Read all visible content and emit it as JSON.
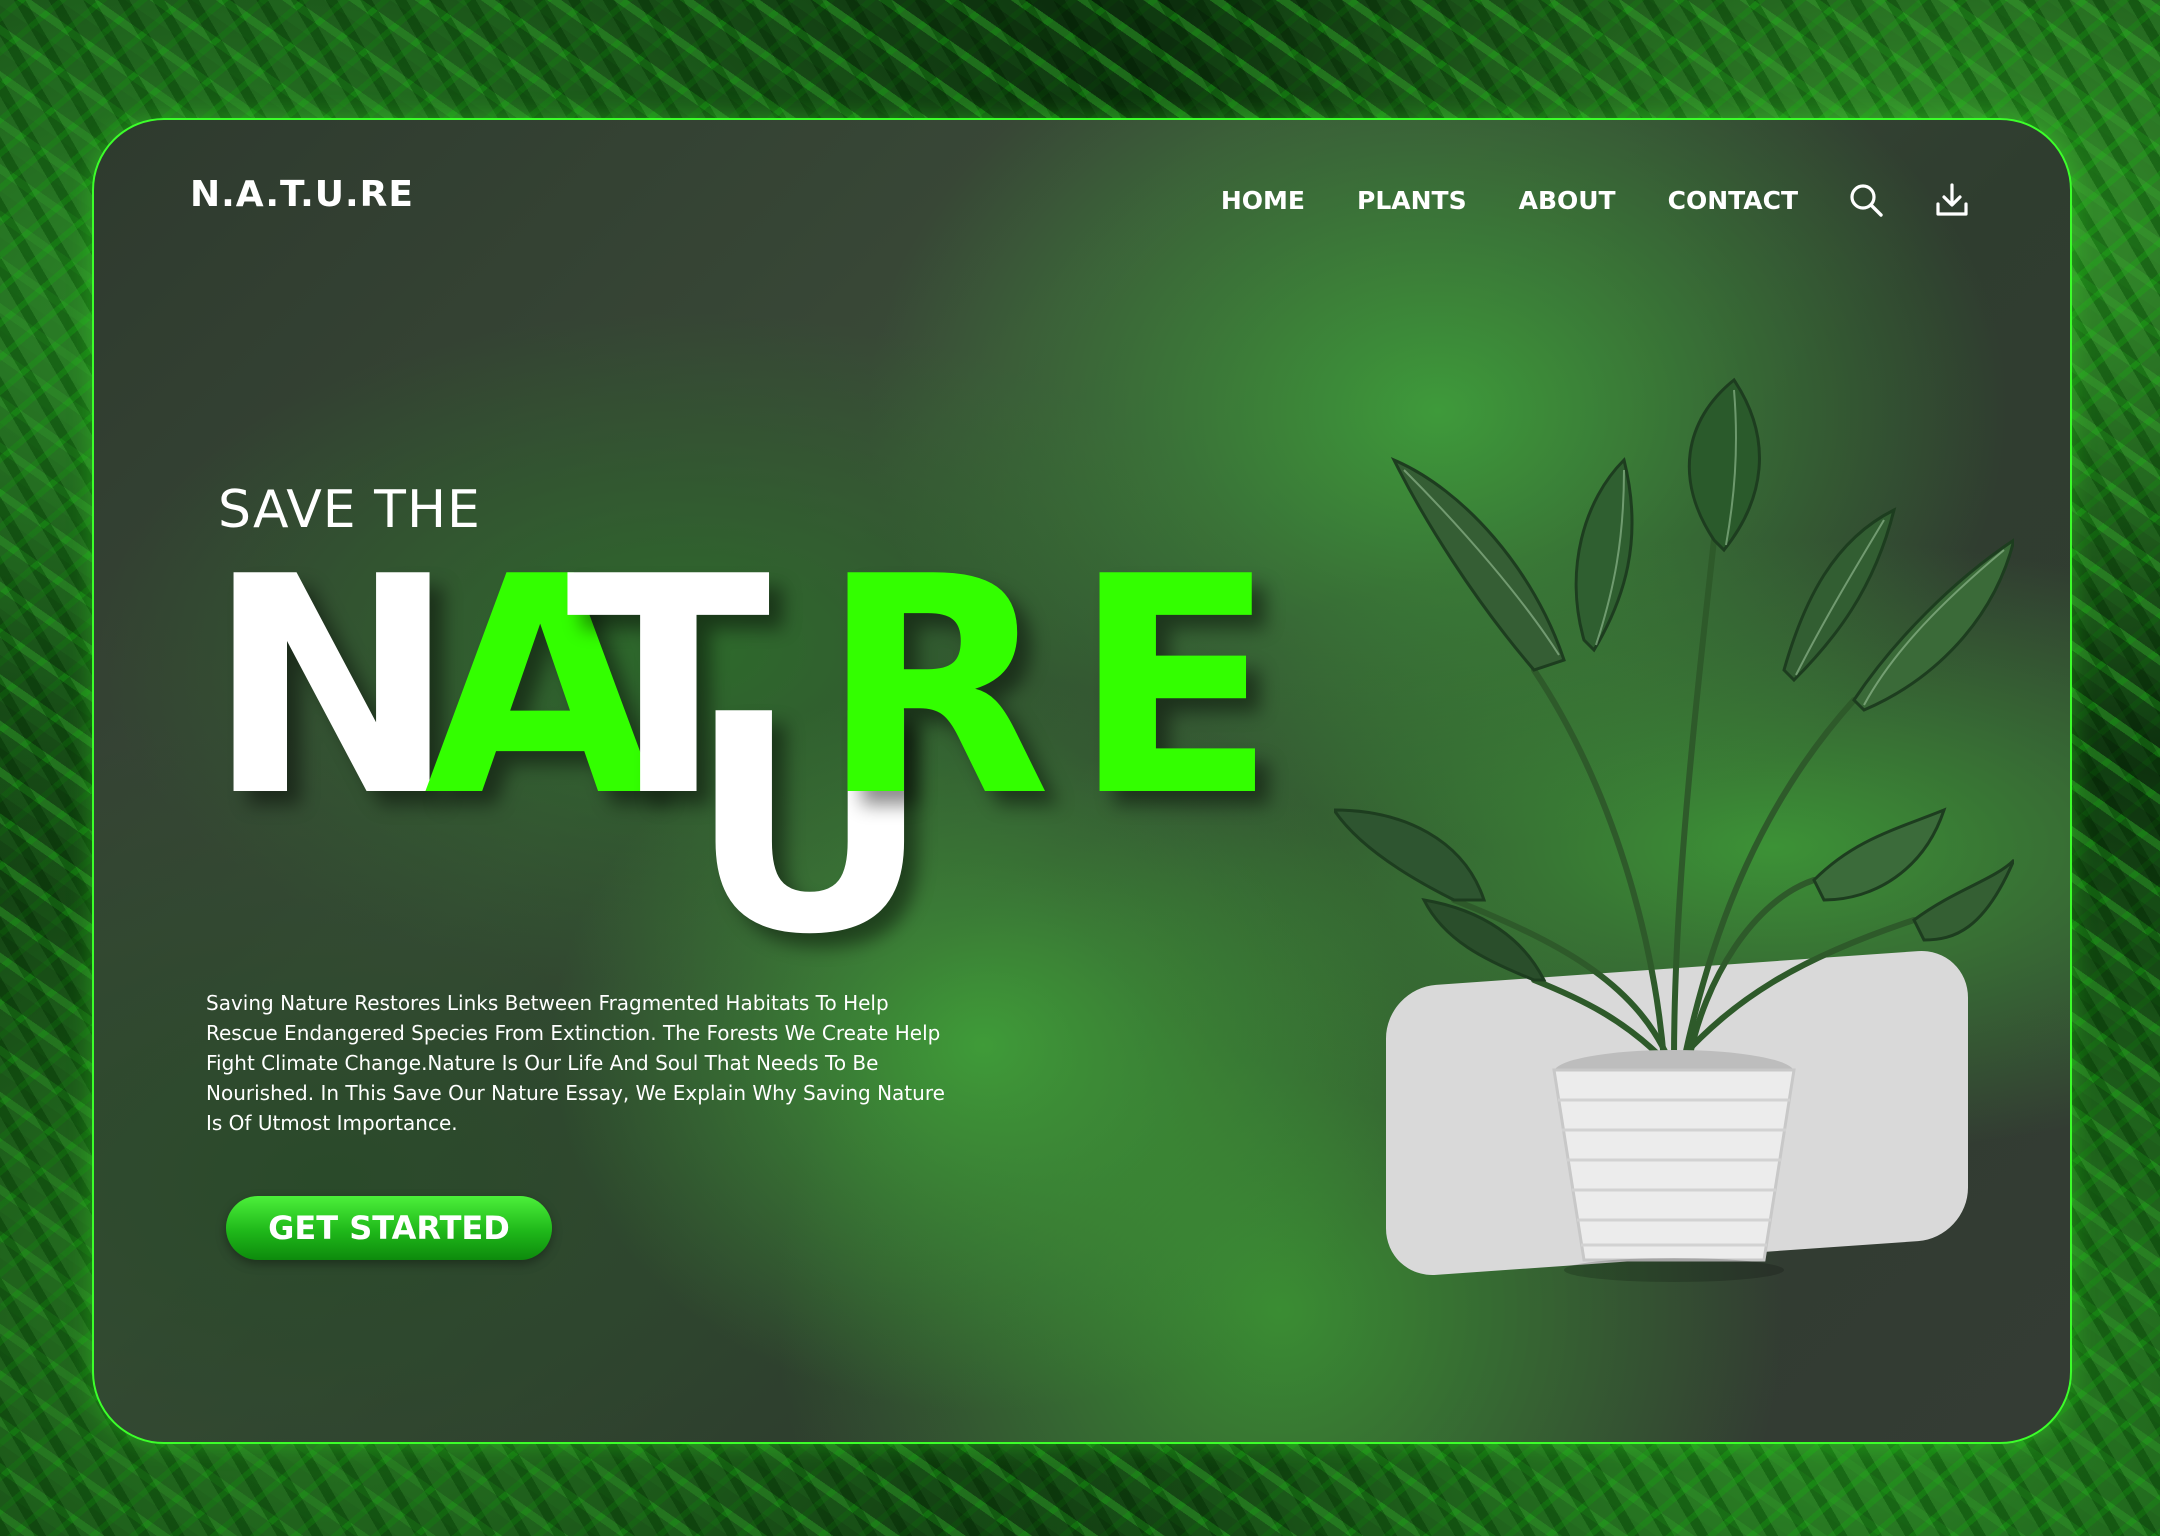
{
  "brand": {
    "logo": "N.A.T.U.RE"
  },
  "nav": {
    "items": [
      {
        "label": "HOME"
      },
      {
        "label": "PLANTS"
      },
      {
        "label": "ABOUT"
      },
      {
        "label": "CONTACT"
      }
    ],
    "icons": [
      "search-icon",
      "download-icon"
    ]
  },
  "hero": {
    "kicker": "SAVE THE",
    "letters": [
      "N",
      "A",
      "T",
      "U",
      "R",
      "E"
    ],
    "description": "Saving Nature Restores Links Between Fragmented Habitats To Help Rescue Endangered Species From Extinction. The Forests We Create Help Fight Climate Change.Nature Is Our Life And Soul That Needs To Be Nourished. In This Save Our Nature Essay, We Explain Why Saving Nature Is Of Utmost Importance.",
    "cta_label": "GET STARTED"
  },
  "colors": {
    "accent": "#33ff00",
    "text": "#ffffff",
    "pedestal": "#d9d9d9",
    "border": "#3cff2a"
  }
}
